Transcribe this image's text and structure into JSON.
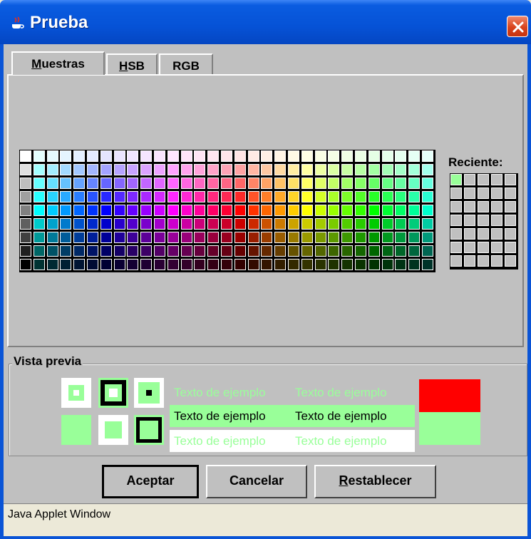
{
  "window": {
    "title": "Prueba",
    "icon": "java-cup-icon",
    "close_icon": "close-icon"
  },
  "tabs": [
    {
      "label": "Muestras",
      "underline": "M",
      "rest": "uestras",
      "active": true
    },
    {
      "label": "HSB",
      "underline": "H",
      "rest": "SB",
      "active": false
    },
    {
      "label": "RGB",
      "underline": "",
      "rest": "RGB",
      "active": false
    }
  ],
  "swatches": {
    "recent_label": "Reciente:",
    "recent_first_color": "#99ff99",
    "recent_empty_color": "#c0c0c0"
  },
  "preview": {
    "title": "Vista previa",
    "sample_text": "Texto de ejemplo",
    "selected_color": "#99ff99",
    "previous_color": "#ff0000"
  },
  "buttons": {
    "ok": "Aceptar",
    "cancel": "Cancelar",
    "reset_underline": "R",
    "reset_rest": "establecer"
  },
  "status": {
    "text": "Java Applet Window"
  },
  "colors": {
    "titlebar": "#0652d6",
    "panel_bg": "#c0c0c0",
    "sample_green": "#99ff99",
    "sample_red": "#ff0000"
  }
}
